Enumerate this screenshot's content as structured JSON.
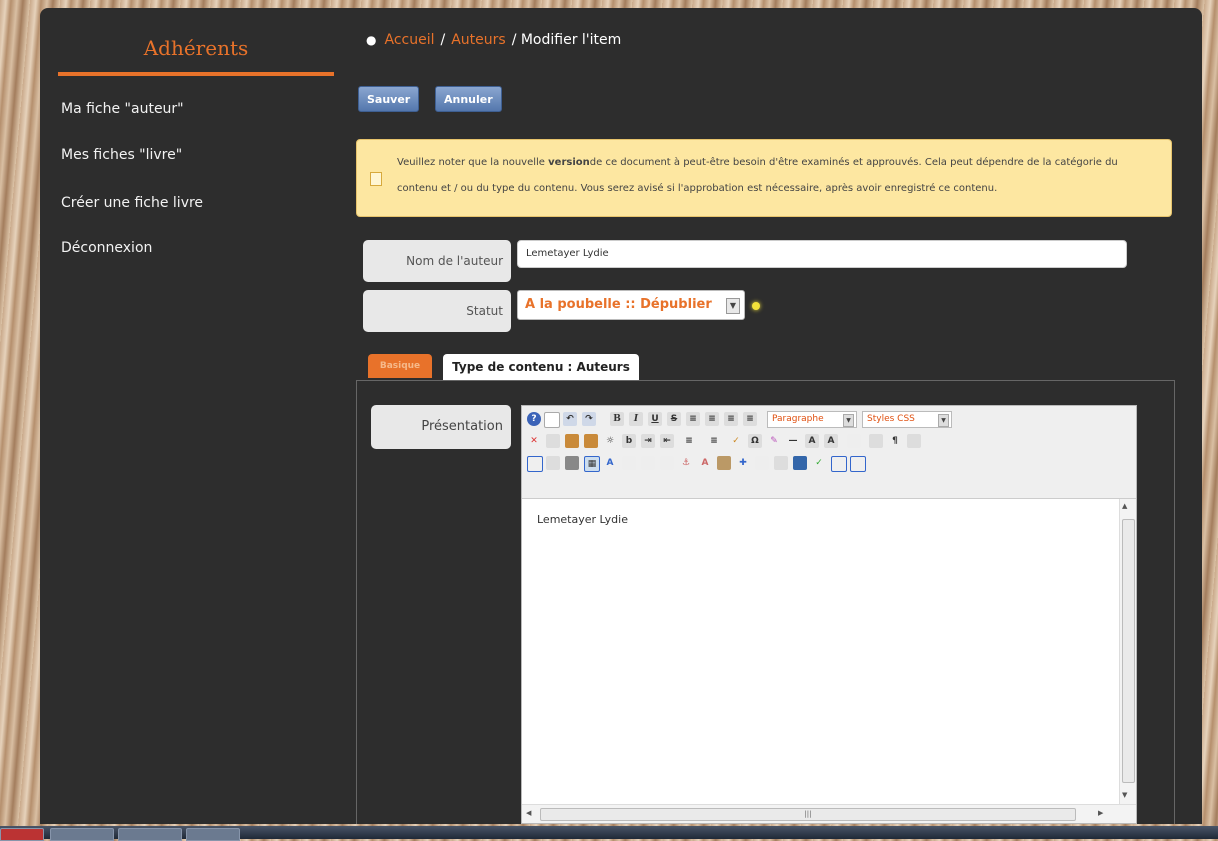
{
  "sidebar": {
    "title": "Adhérents",
    "items": [
      {
        "label": "Ma fiche \"auteur\""
      },
      {
        "label": "Mes fiches \"livre\""
      },
      {
        "label": "Créer une fiche livre"
      },
      {
        "label": "Déconnexion"
      }
    ]
  },
  "breadcrumb": {
    "home": "Accueil",
    "sep1": "/",
    "section": "Auteurs",
    "current": "/ Modifier l'item"
  },
  "toolbar": {
    "save_label": "Sauver",
    "cancel_label": "Annuler"
  },
  "notice": {
    "text_before": "Veuillez noter que la nouvelle ",
    "text_bold": "version",
    "text_after": "de ce document à peut-être besoin d'être examinés et approuvés. Cela peut dépendre de la catégorie du contenu et / ou du type du contenu. Vous serez avisé si l'approbation est nécessaire, après avoir enregistré ce contenu."
  },
  "form": {
    "author_name_label": "Nom de l'auteur",
    "author_name_value": "Lemetayer Lydie",
    "status_label": "Statut",
    "status_value": "A la poubelle :: Dépublier"
  },
  "tabs": [
    {
      "label": "Basique"
    },
    {
      "label": "Type de contenu : Auteurs"
    }
  ],
  "editor": {
    "field_label": "Présentation",
    "format_select": "Paragraphe",
    "styles_select": "Styles CSS",
    "content": "Lemetayer Lydie"
  },
  "colors": {
    "accent": "#e8722a",
    "panel": "#2d2d2d",
    "button": "#5477ad",
    "notice_bg": "#fde7a1"
  }
}
